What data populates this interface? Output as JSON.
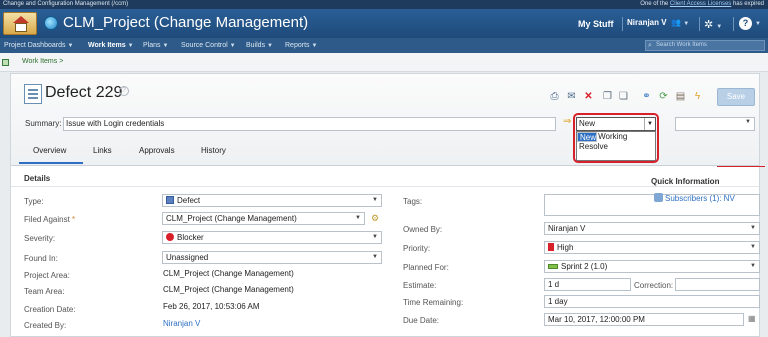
{
  "top_strip": {
    "left_text": "Change and Configuration Management (/ccm)",
    "right_prefix": "One of the",
    "right_link": "Client Access Licenses",
    "right_suffix": "has expired"
  },
  "app_bar": {
    "project_title": "CLM_Project (Change Management)",
    "my_stuff": "My Stuff",
    "user": "Niranjan V"
  },
  "menu": {
    "items": [
      "Project Dashboards",
      "Work Items",
      "Plans",
      "Source Control",
      "Builds",
      "Reports"
    ],
    "active_index": 1,
    "search_placeholder": "Search Work Items"
  },
  "breadcrumb": {
    "text": "Work Items >"
  },
  "work_item": {
    "title": "Defect 229",
    "save_label": "Save",
    "summary_label": "Summary:",
    "required_mark": "*",
    "summary_value": "Issue with Login credentials",
    "state_value": "New",
    "state_options": [
      "New",
      "Start Working",
      "Resolve"
    ],
    "selected_state_index": 0
  },
  "tabs": [
    "Overview",
    "Links",
    "Approvals",
    "History"
  ],
  "active_tab_index": 0,
  "details": {
    "heading": "Details",
    "left_fields": {
      "type_label": "Type:",
      "type_value": "Defect",
      "filed_against_label": "Filed Against",
      "filed_against_value": "CLM_Project (Change Management)",
      "severity_label": "Severity:",
      "severity_value": "Blocker",
      "found_in_label": "Found In:",
      "found_in_value": "Unassigned",
      "project_area_label": "Project Area:",
      "project_area_value": "CLM_Project (Change Management)",
      "team_area_label": "Team Area:",
      "team_area_value": "CLM_Project (Change Management)",
      "creation_date_label": "Creation Date:",
      "creation_date_value": "Feb 26, 2017, 10:53:06 AM",
      "created_by_label": "Created By:",
      "created_by_value": "Niranjan V"
    },
    "right_fields": {
      "tags_label": "Tags:",
      "owned_by_label": "Owned By:",
      "owned_by_value": "Niranjan V",
      "priority_label": "Priority:",
      "priority_value": "High",
      "planned_for_label": "Planned For:",
      "planned_for_value": "Sprint 2 (1.0)",
      "estimate_label": "Estimate:",
      "estimate_value": "1 d",
      "correction_label": "Correction:",
      "time_remaining_label": "Time Remaining:",
      "time_remaining_value": "1 day",
      "due_date_label": "Due Date:",
      "due_date_value": "Mar 10, 2017, 12:00:00 PM"
    },
    "quick_info": {
      "heading": "Quick Information",
      "subscribers": "Subscribers (1): NV"
    }
  }
}
